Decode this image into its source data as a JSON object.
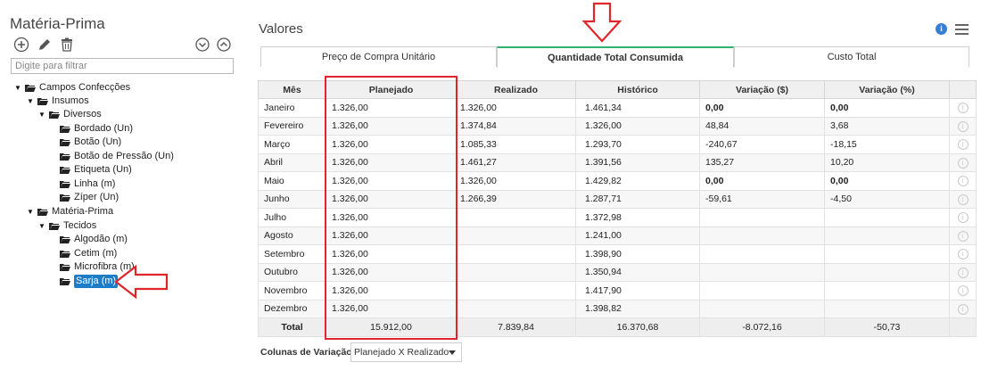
{
  "sidebar": {
    "title": "Matéria-Prima",
    "filter_placeholder": "Digite para filtrar",
    "toolbar": {
      "add_icon": "add-circle-icon",
      "edit_icon": "pencil-icon",
      "delete_icon": "trash-icon",
      "collapse_icon": "chevron-down-circle-icon",
      "expand_icon": "chevron-up-circle-icon"
    },
    "tree": [
      {
        "label": "Campos Confecções",
        "level": 0,
        "expanded": true
      },
      {
        "label": "Insumos",
        "level": 1,
        "expanded": true
      },
      {
        "label": "Diversos",
        "level": 2,
        "expanded": true
      },
      {
        "label": "Bordado (Un)",
        "level": 3
      },
      {
        "label": "Botão (Un)",
        "level": 3
      },
      {
        "label": "Botão de Pressão (Un)",
        "level": 3
      },
      {
        "label": "Etiqueta (Un)",
        "level": 3
      },
      {
        "label": "Linha (m)",
        "level": 3
      },
      {
        "label": "Zíper (Un)",
        "level": 3
      },
      {
        "label": "Matéria-Prima",
        "level": 1,
        "expanded": true
      },
      {
        "label": "Tecidos",
        "level": 2,
        "expanded": true
      },
      {
        "label": "Algodão (m)",
        "level": 3
      },
      {
        "label": "Cetim (m)",
        "level": 3
      },
      {
        "label": "Microfibra (m)",
        "level": 3
      },
      {
        "label": "Sarja (m)",
        "level": 3,
        "selected": true
      }
    ]
  },
  "main": {
    "title": "Valores",
    "tabs": [
      {
        "label": "Preço de Compra Unitário",
        "active": false
      },
      {
        "label": "Quantidade Total Consumida",
        "active": true
      },
      {
        "label": "Custo Total",
        "active": false
      }
    ],
    "table": {
      "headers": [
        "Mês",
        "Planejado",
        "Realizado",
        "Histórico",
        "Variação ($)",
        "Variação (%)",
        ""
      ],
      "rows": [
        {
          "mes": "Janeiro",
          "planejado": "1.326,00",
          "realizado": "1.326,00",
          "historico": "1.461,34",
          "var_abs": "0,00",
          "var_pct": "0,00",
          "tone": "neutral"
        },
        {
          "mes": "Fevereiro",
          "planejado": "1.326,00",
          "realizado": "1.374,84",
          "historico": "1.326,00",
          "var_abs": "48,84",
          "var_pct": "3,68",
          "tone": "red"
        },
        {
          "mes": "Março",
          "planejado": "1.326,00",
          "realizado": "1.085,33",
          "historico": "1.293,70",
          "var_abs": "-240,67",
          "var_pct": "-18,15",
          "tone": "green"
        },
        {
          "mes": "Abril",
          "planejado": "1.326,00",
          "realizado": "1.461,27",
          "historico": "1.391,56",
          "var_abs": "135,27",
          "var_pct": "10,20",
          "tone": "red"
        },
        {
          "mes": "Maio",
          "planejado": "1.326,00",
          "realizado": "1.326,00",
          "historico": "1.429,82",
          "var_abs": "0,00",
          "var_pct": "0,00",
          "tone": "neutral"
        },
        {
          "mes": "Junho",
          "planejado": "1.326,00",
          "realizado": "1.266,39",
          "historico": "1.287,71",
          "var_abs": "-59,61",
          "var_pct": "-4,50",
          "tone": "green"
        },
        {
          "mes": "Julho",
          "planejado": "1.326,00",
          "realizado": "",
          "historico": "1.372,98",
          "var_abs": "",
          "var_pct": "",
          "tone": "neutral"
        },
        {
          "mes": "Agosto",
          "planejado": "1.326,00",
          "realizado": "",
          "historico": "1.241,00",
          "var_abs": "",
          "var_pct": "",
          "tone": "neutral"
        },
        {
          "mes": "Setembro",
          "planejado": "1.326,00",
          "realizado": "",
          "historico": "1.398,90",
          "var_abs": "",
          "var_pct": "",
          "tone": "neutral"
        },
        {
          "mes": "Outubro",
          "planejado": "1.326,00",
          "realizado": "",
          "historico": "1.350,94",
          "var_abs": "",
          "var_pct": "",
          "tone": "neutral"
        },
        {
          "mes": "Novembro",
          "planejado": "1.326,00",
          "realizado": "",
          "historico": "1.417,90",
          "var_abs": "",
          "var_pct": "",
          "tone": "neutral"
        },
        {
          "mes": "Dezembro",
          "planejado": "1.326,00",
          "realizado": "",
          "historico": "1.398,82",
          "var_abs": "",
          "var_pct": "",
          "tone": "neutral"
        }
      ],
      "total": {
        "label": "Total",
        "planejado": "15.912,00",
        "realizado": "7.839,84",
        "historico": "16.370,68",
        "var_abs": "-8.072,16",
        "var_pct": "-50,73"
      },
      "row_info_icon": "info-circle-icon"
    },
    "variation": {
      "label": "Colunas de Variação:",
      "selected": "Planejado X Realizado"
    },
    "info_icon": "info-icon",
    "menu_icon": "hamburger-menu-icon"
  },
  "colors": {
    "accent_tab": "#2fb26b",
    "negative_bad": "#e0252c",
    "positive_good": "#2a8a2a",
    "selection": "#1c7cc7",
    "annotation": "#e0252c"
  }
}
